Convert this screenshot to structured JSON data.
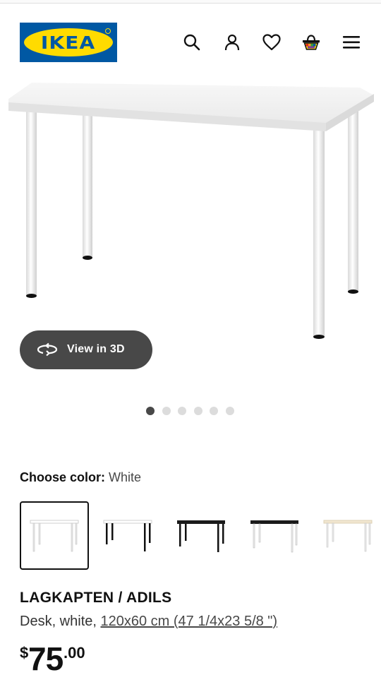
{
  "header": {
    "logo_text": "IKEA",
    "icons": [
      "search-icon",
      "user-icon",
      "heart-icon",
      "cart-icon",
      "menu-icon"
    ]
  },
  "gallery": {
    "view3d_label": "View in 3D",
    "total_images": 6,
    "active_index": 0
  },
  "color_chooser": {
    "label": "Choose color:",
    "selected_value": "White",
    "swatches": [
      {
        "name": "white-white",
        "top": "#ffffff",
        "legs": "#ffffff",
        "selected": true
      },
      {
        "name": "white-black",
        "top": "#ffffff",
        "legs": "#111111",
        "selected": false
      },
      {
        "name": "black-brown-black",
        "top": "#1a1a1a",
        "legs": "#1a1a1a",
        "selected": false
      },
      {
        "name": "black-brown-white",
        "top": "#1a1a1a",
        "legs": "#ffffff",
        "selected": false
      },
      {
        "name": "birch-white",
        "top": "#f1e6d0",
        "legs": "#ffffff",
        "selected": false
      }
    ]
  },
  "product": {
    "name": "LAGKAPTEN / ADILS",
    "desc_prefix": "Desk, white, ",
    "dimensions": "120x60 cm (47 1/4x23 5/8 \")",
    "price_currency": "$",
    "price_integer": "75",
    "price_decimal": ".00"
  },
  "colors": {
    "brand_blue": "#0058a3",
    "brand_yellow": "#ffdb00",
    "button_dark": "#484848"
  }
}
